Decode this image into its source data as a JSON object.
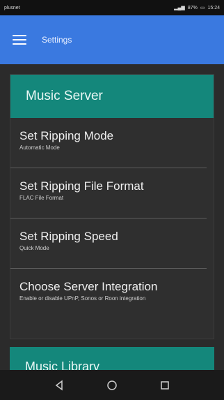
{
  "status_bar": {
    "carrier": "plusnet",
    "time": "15:24",
    "battery": "87%"
  },
  "app_bar": {
    "title": "Settings",
    "menu_icon": "hamburger-menu-icon"
  },
  "sections": [
    {
      "title": "Music Server",
      "items": [
        {
          "title": "Set Ripping Mode",
          "subtitle": "Automatic Mode"
        },
        {
          "title": "Set Ripping File Format",
          "subtitle": "FLAC File Format"
        },
        {
          "title": "Set Ripping Speed",
          "subtitle": "Quick Mode"
        },
        {
          "title": "Choose Server Integration",
          "subtitle": "Enable or disable UPnP, Sonos or Roon integration"
        }
      ]
    },
    {
      "title": "Music Library",
      "items": []
    }
  ],
  "colors": {
    "app_bar": "#3a79e0",
    "section_header": "#14877b",
    "background": "#2b2b2b"
  },
  "nav": {
    "back_icon": "triangle-back-icon",
    "home_icon": "circle-home-icon",
    "recents_icon": "square-recents-icon"
  }
}
